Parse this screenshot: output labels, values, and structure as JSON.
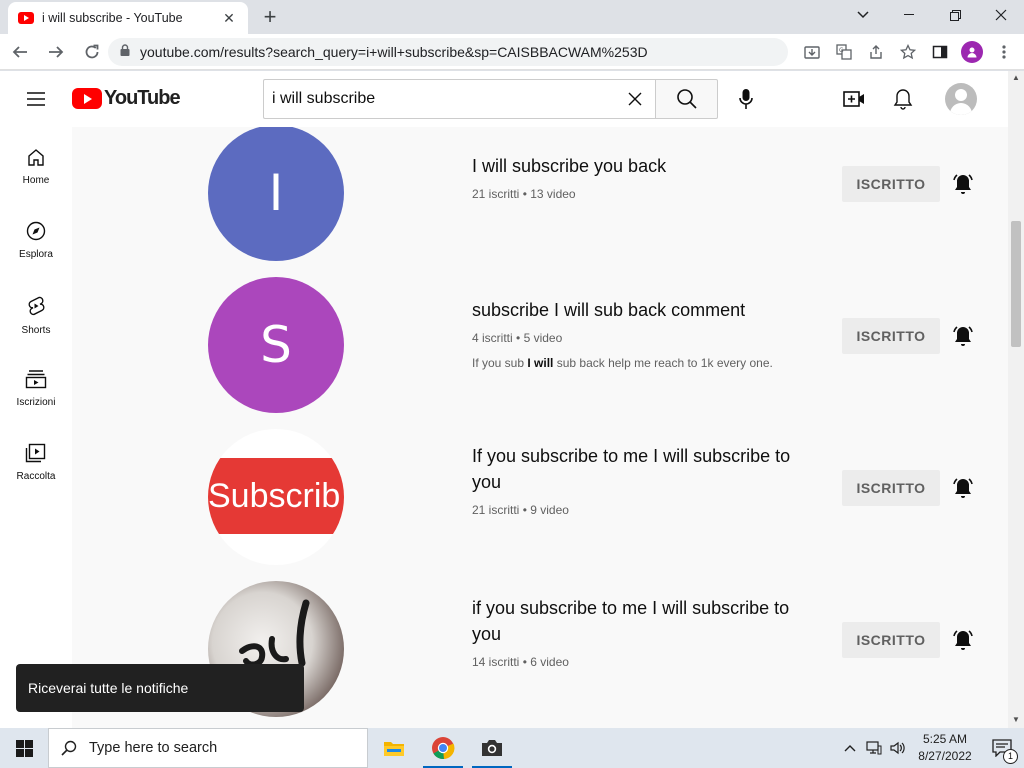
{
  "browser": {
    "tab_title": "i will subscribe - YouTube",
    "url": "youtube.com/results?search_query=i+will+subscribe&sp=CAISBBACWAM%253D"
  },
  "masthead": {
    "logo_text": "YouTube",
    "search_value": "i will subscribe"
  },
  "guide": {
    "items": [
      {
        "label": "Home",
        "icon": "home-icon"
      },
      {
        "label": "Esplora",
        "icon": "compass-icon"
      },
      {
        "label": "Shorts",
        "icon": "shorts-icon"
      },
      {
        "label": "Iscrizioni",
        "icon": "subscriptions-icon"
      },
      {
        "label": "Raccolta",
        "icon": "library-icon"
      }
    ]
  },
  "results": [
    {
      "avatar_letter": "I",
      "avatar_color": "#5c6bc0",
      "title": "I will subscribe you back",
      "subscribers": "21 iscritti",
      "videos": "13 video",
      "button": "ISCRITTO"
    },
    {
      "avatar_letter": "S",
      "avatar_color": "#ab47bc",
      "title": "subscribe I will sub back comment",
      "subscribers": "4 iscritti",
      "videos": "5 video",
      "desc_pre": "If you sub ",
      "desc_bold": "I will",
      "desc_post": " sub back help me reach to 1k every one.",
      "button": "ISCRITTO"
    },
    {
      "avatar_text": "Subscrib",
      "avatar_color": "#e53935",
      "title": "If you subscribe to me I will subscribe to you",
      "subscribers": "21 iscritti",
      "videos": "9 video",
      "button": "ISCRITTO"
    },
    {
      "title": "if you subscribe to me I will subscribe to you",
      "subscribers": "14 iscritti",
      "videos": "6 video",
      "button": "ISCRITTO"
    }
  ],
  "meta_separator": "•",
  "toast": "Riceverai tutte le notifiche",
  "taskbar": {
    "search_placeholder": "Type here to search",
    "time": "5:25 AM",
    "date": "8/27/2022",
    "notification_count": "1"
  }
}
